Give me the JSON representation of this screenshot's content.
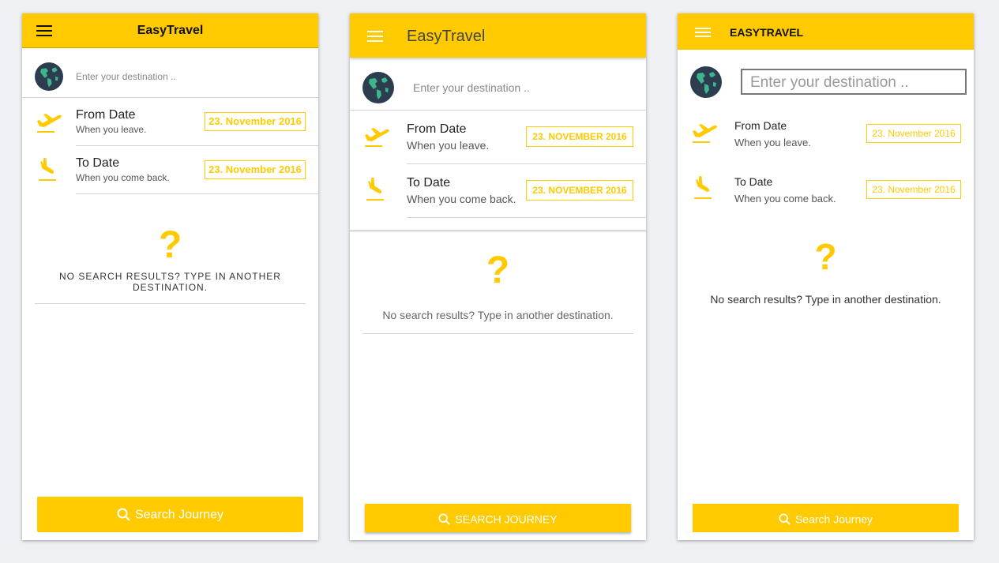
{
  "theme": {
    "accent": "#ffcb00",
    "globe_ocean": "#2b3d4f",
    "globe_land": "#3fb58e"
  },
  "screens": [
    {
      "app_title": "EasyTravel",
      "menu_icon": "hamburger-menu-icon",
      "destination_placeholder": "Enter your destination ..",
      "from": {
        "label": "From Date",
        "sub": "When you leave.",
        "date": "23. November 2016"
      },
      "to": {
        "label": "To Date",
        "sub": "When you come back.",
        "date": "23. November 2016"
      },
      "empty_icon": "?",
      "empty_message": "NO SEARCH RESULTS? TYPE IN ANOTHER DESTINATION.",
      "search_button": "Search Journey"
    },
    {
      "app_title": "EasyTravel",
      "menu_icon": "hamburger-menu-icon",
      "destination_placeholder": "Enter your destination ..",
      "from": {
        "label": "From Date",
        "sub": "When you leave.",
        "date": "23. NOVEMBER 2016"
      },
      "to": {
        "label": "To Date",
        "sub": "When you come back.",
        "date": "23. NOVEMBER 2016"
      },
      "empty_icon": "?",
      "empty_message": "No search results? Type in another destination.",
      "search_button": "SEARCH JOURNEY"
    },
    {
      "app_title": "EASYTRAVEL",
      "menu_icon": "hamburger-menu-icon",
      "destination_placeholder": "Enter your destination ..",
      "from": {
        "label": "From Date",
        "sub": "When you leave.",
        "date": "23. November 2016"
      },
      "to": {
        "label": "To Date",
        "sub": "When you come back.",
        "date": "23. November 2016"
      },
      "empty_icon": "?",
      "empty_message": "No search results? Type in another destination.",
      "search_button": "Search Journey"
    }
  ]
}
